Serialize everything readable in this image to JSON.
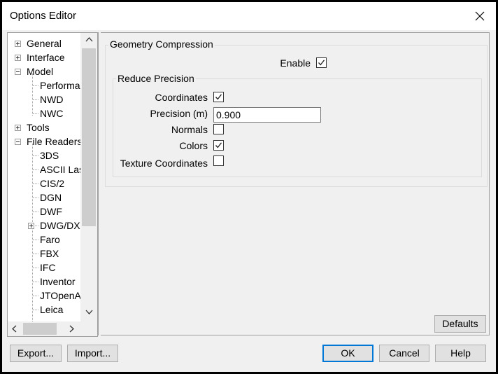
{
  "window": {
    "title": "Options Editor"
  },
  "tree": {
    "items": [
      {
        "label": "General",
        "expander": "plus"
      },
      {
        "label": "Interface",
        "expander": "plus"
      },
      {
        "label": "Model",
        "expander": "minus"
      },
      {
        "label": "Performa",
        "expander": "none"
      },
      {
        "label": "NWD",
        "expander": "none",
        "selected": true
      },
      {
        "label": "NWC",
        "expander": "none"
      },
      {
        "label": "Tools",
        "expander": "plus"
      },
      {
        "label": "File Readers",
        "expander": "minus"
      },
      {
        "label": "3DS",
        "expander": "none"
      },
      {
        "label": "ASCII Las",
        "expander": "none"
      },
      {
        "label": "CIS/2",
        "expander": "none"
      },
      {
        "label": "DGN",
        "expander": "none"
      },
      {
        "label": "DWF",
        "expander": "none"
      },
      {
        "label": "DWG/DX",
        "expander": "plus"
      },
      {
        "label": "Faro",
        "expander": "none"
      },
      {
        "label": "FBX",
        "expander": "none"
      },
      {
        "label": "IFC",
        "expander": "none"
      },
      {
        "label": "Inventor",
        "expander": "none"
      },
      {
        "label": "JTOpenA",
        "expander": "none"
      },
      {
        "label": "Leica",
        "expander": "none"
      }
    ]
  },
  "geometry_compression": {
    "legend": "Geometry Compression",
    "enable_label": "Enable",
    "enable_checked": true,
    "reduce_precision": {
      "legend": "Reduce Precision",
      "coordinates_label": "Coordinates",
      "coordinates_checked": true,
      "precision_label": "Precision (m)",
      "precision_value": "0.900",
      "normals_label": "Normals",
      "normals_checked": false,
      "colors_label": "Colors",
      "colors_checked": true,
      "texture_label": "Texture Coordinates",
      "texture_checked": false
    }
  },
  "buttons": {
    "defaults": "Defaults",
    "export": "Export...",
    "import": "Import...",
    "ok": "OK",
    "cancel": "Cancel",
    "help": "Help"
  },
  "colors": {
    "accent": "#0078d7",
    "window_bg": "#f0f0f0",
    "frame": "#000000"
  }
}
